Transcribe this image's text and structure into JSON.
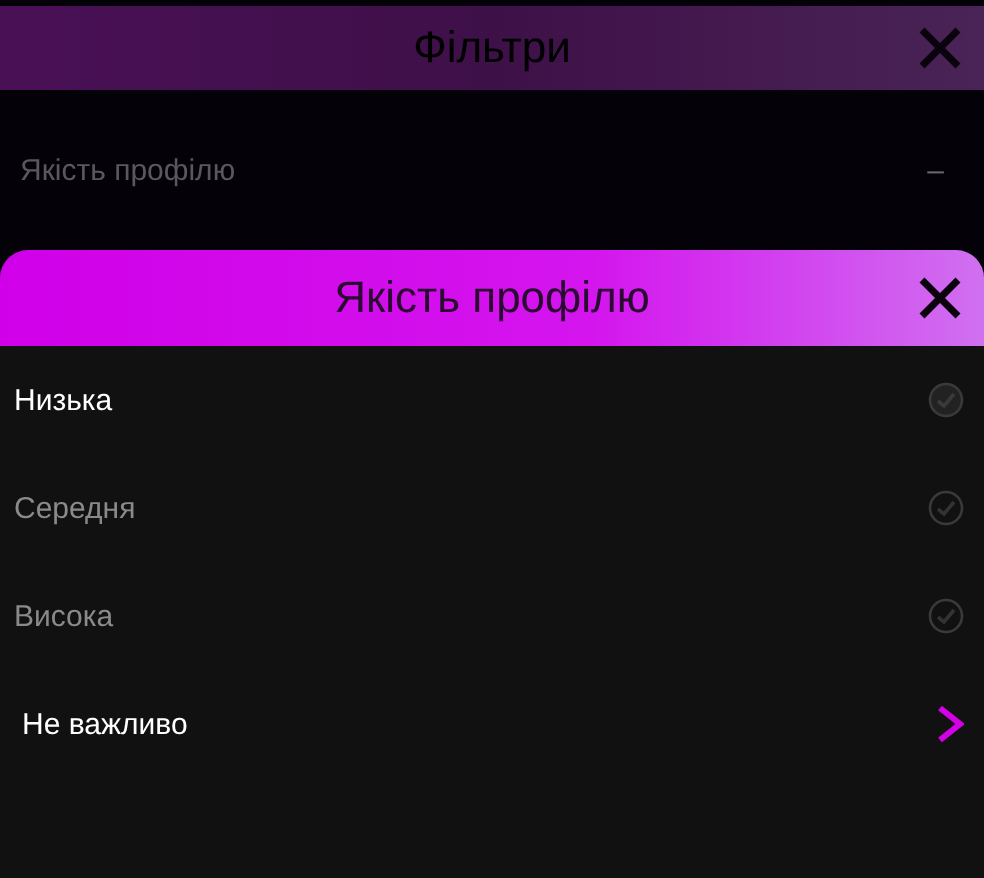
{
  "background": {
    "title": "Фільтри",
    "filter": {
      "label": "Якість профілю",
      "value": "–"
    }
  },
  "sheet": {
    "title": "Якість профілю",
    "options": [
      {
        "label": "Низька",
        "kind": "check",
        "selected": true
      },
      {
        "label": "Середня",
        "kind": "check",
        "selected": false
      },
      {
        "label": "Висока",
        "kind": "check",
        "selected": false
      },
      {
        "label": "Не важливо",
        "kind": "link"
      }
    ]
  }
}
